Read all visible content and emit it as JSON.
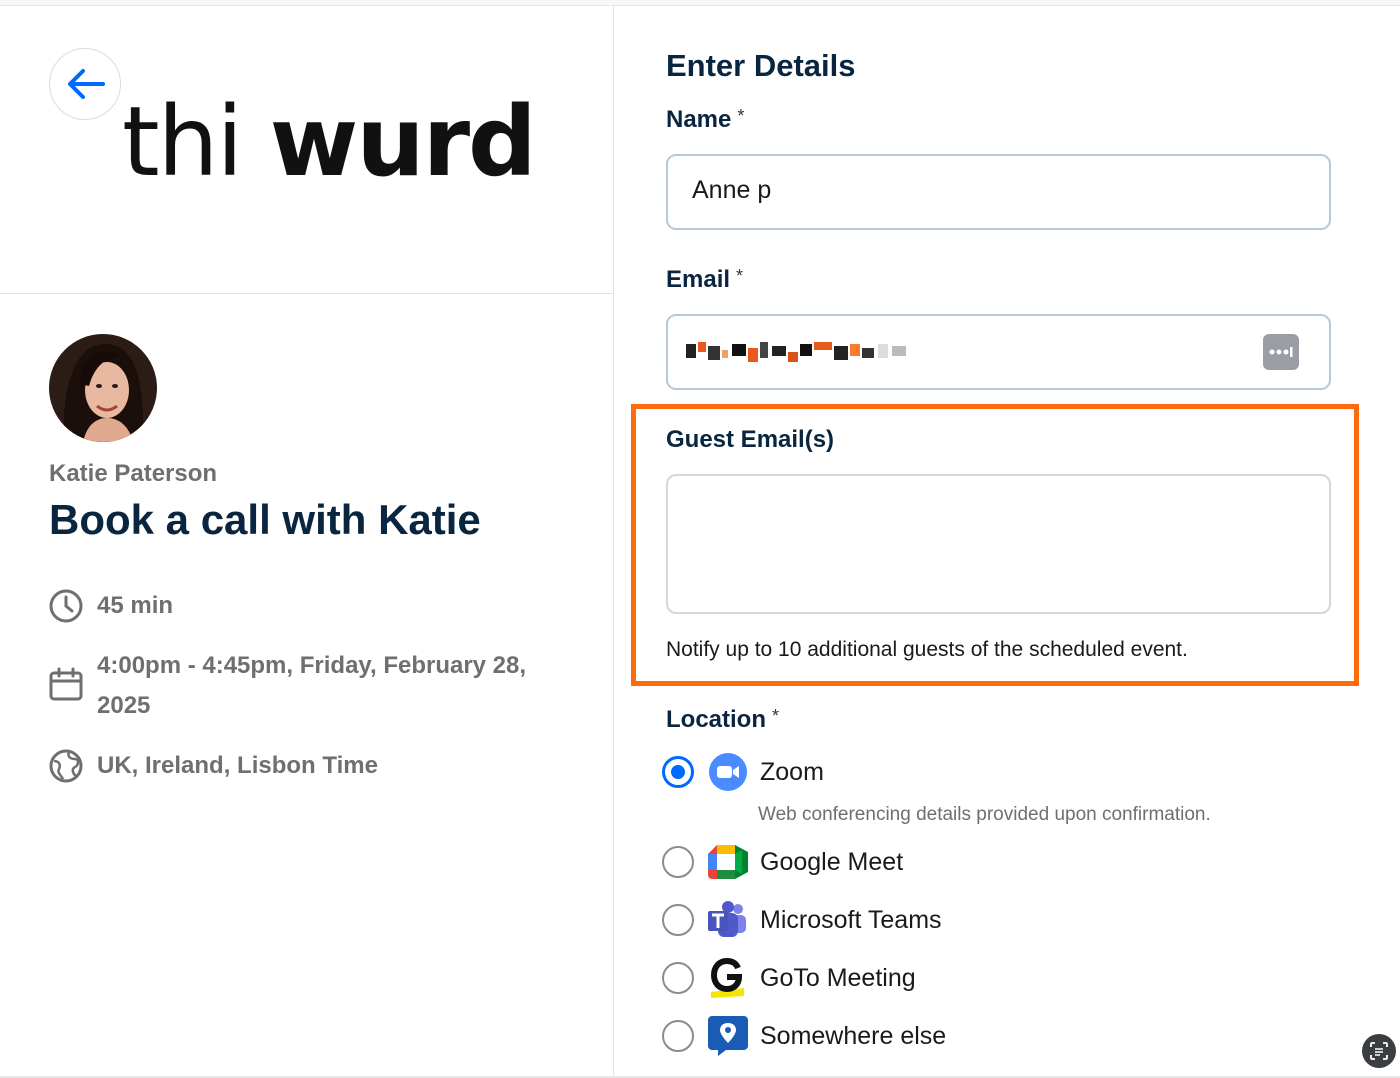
{
  "left": {
    "back_button_label": "",
    "logo": {
      "light": "thi",
      "bold": "wurd"
    },
    "host_name": "Katie Paterson",
    "event_title": "Book a call with Katie",
    "duration": "45 min",
    "datetime": "4:00pm - 4:45pm, Friday, February 28, 2025",
    "timezone": "UK, Ireland, Lisbon Time"
  },
  "form": {
    "heading": "Enter Details",
    "name": {
      "label": "Name",
      "required": "*",
      "value": "Anne p"
    },
    "email": {
      "label": "Email",
      "required": "*"
    },
    "guests": {
      "label": "Guest Email(s)",
      "value": "",
      "hint": "Notify up to 10 additional guests of the scheduled event."
    },
    "location": {
      "label": "Location",
      "required": "*",
      "selected": "Zoom",
      "options": [
        {
          "label": "Zoom",
          "icon": "zoom-icon",
          "description": "Web conferencing details provided upon confirmation."
        },
        {
          "label": "Google Meet",
          "icon": "google-meet-icon"
        },
        {
          "label": "Microsoft Teams",
          "icon": "microsoft-teams-icon"
        },
        {
          "label": "GoTo Meeting",
          "icon": "goto-meeting-icon"
        },
        {
          "label": "Somewhere else",
          "icon": "location-pin-icon"
        }
      ]
    }
  },
  "colors": {
    "accent": "#0069ff",
    "highlight": "#ff6a0d",
    "heading": "#0a2540",
    "muted": "#6f6f6f"
  }
}
